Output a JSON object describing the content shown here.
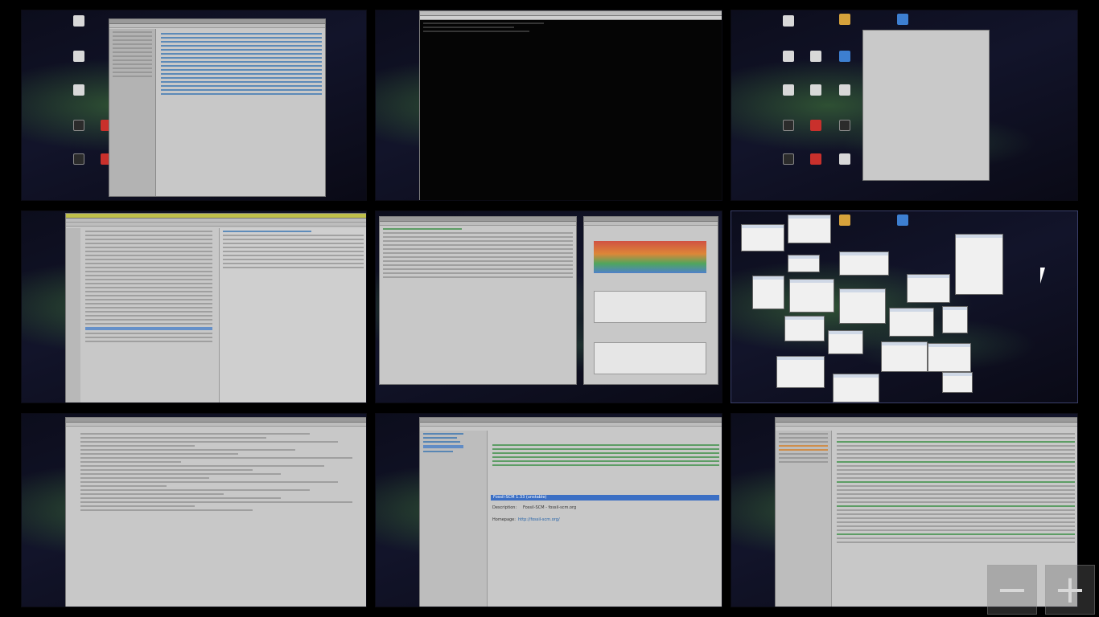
{
  "overview": {
    "mode": "desktop-grid",
    "rows": 3,
    "columns": 3,
    "active_desktop": 6
  },
  "desktops": [
    {
      "index": 1,
      "window": "file-manager"
    },
    {
      "index": 2,
      "window": "terminal"
    },
    {
      "index": 3,
      "window": "blank-dialog"
    },
    {
      "index": 4,
      "window": "mail-client"
    },
    {
      "index": 5,
      "window": "downloads-and-system-monitor"
    },
    {
      "index": 6,
      "window": "thumbnail-cloud"
    },
    {
      "index": 7,
      "window": "text-editor"
    },
    {
      "index": 8,
      "window": "package-manager"
    },
    {
      "index": 9,
      "window": "log-viewer"
    }
  ],
  "package_manager": {
    "selected_package": "Fossil-SCM 1.33 (unstable)",
    "description_label": "Description:",
    "description_value": "Fossil-SCM - fossil-scm.org",
    "homepage_label": "Homepage:",
    "homepage_url": "http://fossil-scm.org/"
  },
  "zoom": {
    "zoom_out_symbol": "−",
    "zoom_in_symbol": "+"
  },
  "colors": {
    "background": "#000000",
    "window_gray": "#c8c8c8",
    "selection_blue": "#3b6fc4",
    "link_blue": "#1f5fa8",
    "terminal_green": "#2f8a3a"
  }
}
